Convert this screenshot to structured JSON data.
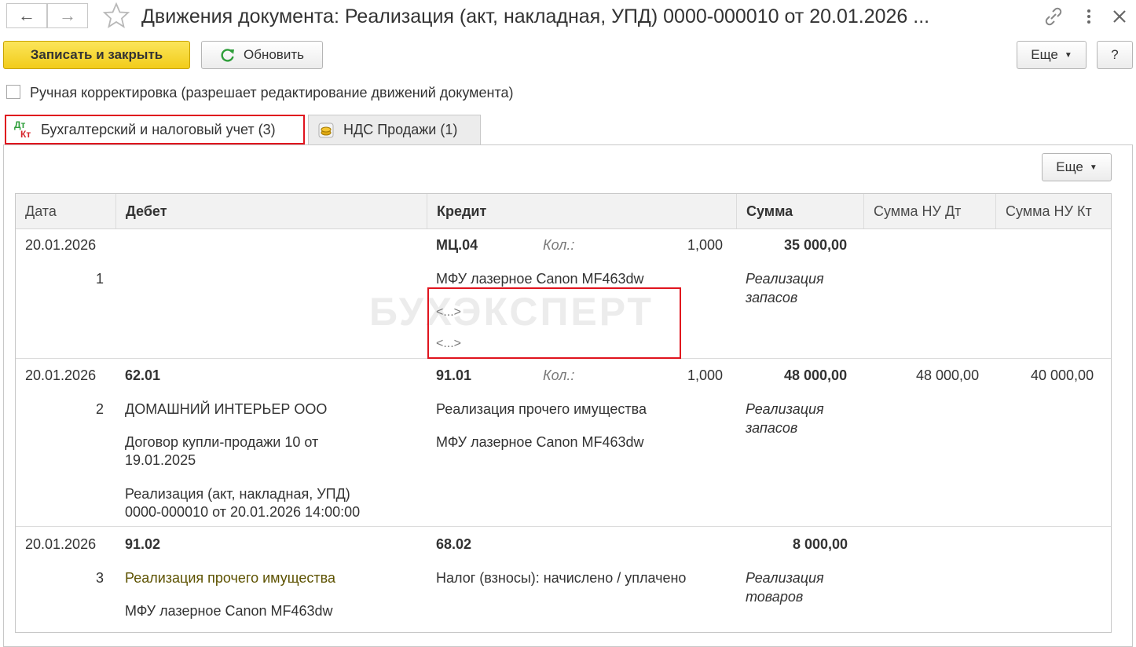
{
  "window": {
    "title": "Движения документа: Реализация (акт, накладная, УПД) 0000-000010 от 20.01.2026 ...",
    "back_icon": "arrow-left-icon",
    "forward_icon": "arrow-right-icon",
    "favorite_icon": "star-icon",
    "link_icon": "link-icon",
    "menu_icon": "kebab-menu-icon",
    "close_icon": "close-icon"
  },
  "toolbar": {
    "save_close_label": "Записать и закрыть",
    "refresh_label": "Обновить",
    "more_label": "Еще",
    "help_label": "?"
  },
  "manual_edit": {
    "label": "Ручная корректировка (разрешает редактирование движений документа)",
    "checked": false
  },
  "tabs": [
    {
      "label": "Бухгалтерский и налоговый учет (3)",
      "icon": "dt-kt-icon",
      "active": true
    },
    {
      "label": "НДС Продажи (1)",
      "icon": "coins-icon",
      "active": false
    }
  ],
  "tab_icon_text": {
    "dt": "Дт",
    "kt": "Кт"
  },
  "grid": {
    "more_label": "Еще",
    "columns": [
      "Дата",
      "Дебет",
      "Кредит",
      "Сумма",
      "Сумма НУ Дт",
      "Сумма НУ Кт"
    ],
    "watermark": "БУХЭКСПЕРТ",
    "rows": [
      {
        "date": "20.01.2026",
        "num": "1",
        "debit_account": "",
        "debit_lines": [],
        "credit_account": "МЦ.04",
        "qty_label": "Кол.:",
        "qty": "1,000",
        "credit_lines": [
          "МФУ лазерное Canon MF463dw",
          "<...>",
          "<...>"
        ],
        "sum": "35 000,00",
        "sum_note": [
          "Реализация",
          "запасов"
        ],
        "nu_dt": "",
        "nu_kt": ""
      },
      {
        "date": "20.01.2026",
        "num": "2",
        "debit_account": "62.01",
        "debit_lines": [
          "ДОМАШНИЙ ИНТЕРЬЕР ООО",
          "Договор купли-продажи 10 от",
          "19.01.2025",
          "Реализация (акт, накладная, УПД)",
          "0000-000010 от 20.01.2026 14:00:00"
        ],
        "credit_account": "91.01",
        "qty_label": "Кол.:",
        "qty": "1,000",
        "credit_lines": [
          "Реализация прочего имущества",
          "МФУ лазерное Canon MF463dw"
        ],
        "sum": "48 000,00",
        "sum_note": [
          "Реализация",
          "запасов"
        ],
        "nu_dt": "48 000,00",
        "nu_kt": "40 000,00"
      },
      {
        "date": "20.01.2026",
        "num": "3",
        "debit_account": "91.02",
        "debit_lines": [
          "Реализация прочего имущества",
          "МФУ лазерное Canon MF463dw"
        ],
        "credit_account": "68.02",
        "qty_label": "",
        "qty": "",
        "credit_lines": [
          "Налог (взносы): начислено / уплачено"
        ],
        "sum": "8 000,00",
        "sum_note": [
          "Реализация",
          "товаров"
        ],
        "nu_dt": "",
        "nu_kt": ""
      }
    ]
  },
  "colors": {
    "primary_button": "#f2cc1a",
    "highlight_red": "#e0141e",
    "refresh_icon_green": "#2e9e3a",
    "header_bg": "#f2f2f2"
  }
}
